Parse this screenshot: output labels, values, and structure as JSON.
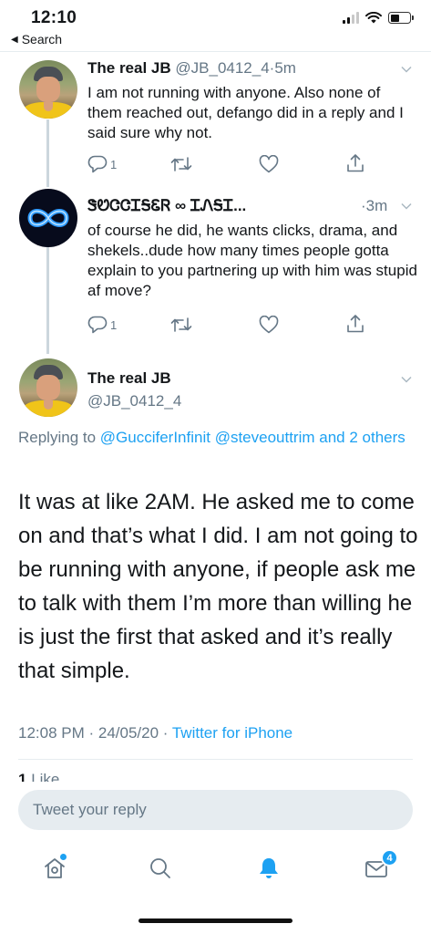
{
  "status_bar": {
    "time": "12:10",
    "back_label": "Search"
  },
  "tweets": [
    {
      "name": "The real JB",
      "handle": "@JB_0412_4",
      "sep": "·",
      "time": "5m",
      "text": "I am not running with anyone. Also none of them reached out, defango did in a reply and I said sure why not.",
      "reply_count": "1"
    },
    {
      "name": "ᏕᏬᏣᏣᏆᎦᏋᏒ ∞ ᏆᏁᎦᏆ...",
      "sep": "·",
      "time": "3m",
      "text": "of course he did,  he wants clicks, drama, and shekels..dude how many times people gotta explain to you partnering up with him was stupid af move?",
      "reply_count": "1"
    }
  ],
  "main_tweet": {
    "name": "The real JB",
    "handle": "@JB_0412_4",
    "replying_prefix": "Replying to ",
    "replying_mentions": "@GucciferInfinit @steveouttrim and 2 others",
    "text": "It was at like 2AM. He asked me to come on and that’s what I did. I am not going to be running with anyone, if people ask me to talk with them I’m more than willing he is just the first that asked and it’s really that simple.",
    "timestamp": "12:08 PM · 24/05/20 · ",
    "source": "Twitter for iPhone",
    "like_count": "1",
    "like_label": "Like"
  },
  "composer": {
    "placeholder": "Tweet your reply"
  },
  "tab_bar": {
    "messages_badge": "4"
  },
  "colors": {
    "accent": "#1da1f2",
    "secondary_text": "#657786",
    "divider": "#e6ecf0"
  }
}
